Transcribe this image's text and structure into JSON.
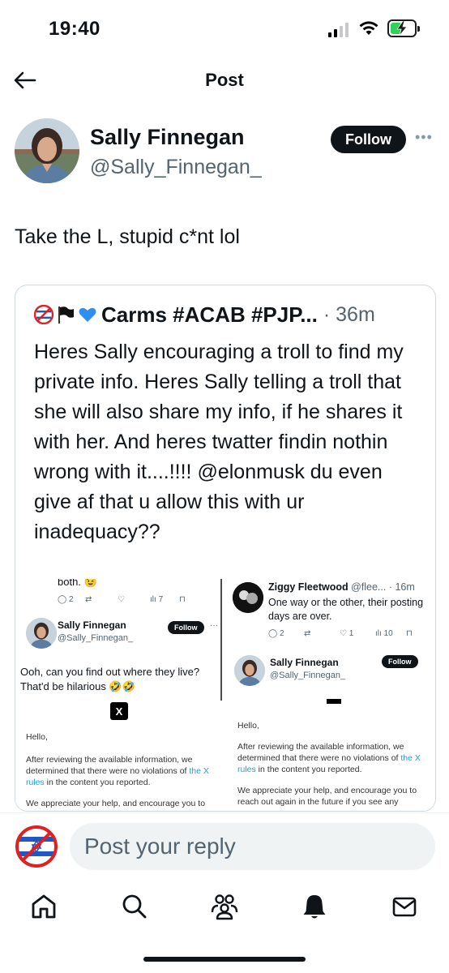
{
  "status_bar": {
    "time": "19:40",
    "battery_level": 0.44,
    "battery_color": "#30d158"
  },
  "header": {
    "title": "Post"
  },
  "post": {
    "author_name": "Sally Finnegan",
    "author_handle": "@Sally_Finnegan_",
    "follow_label": "Follow",
    "text": "Take the L, stupid c*nt lol"
  },
  "quoted": {
    "emojis": [
      "no-entry-flag-emoji",
      "black-flag-emoji",
      "blue-heart-emoji"
    ],
    "author_name": "Carms #ACAB #PJP...",
    "time": "36m",
    "text": "Heres Sally encouraging a troll to find my private info. Heres Sally telling a troll that she will also share my info, if he shares it with her. And heres twatter findin nothin wrong with it....!!!! @elonmusk du even give af that u allow this with ur inadequacy??",
    "media": {
      "left": {
        "top_text": "both. 😉",
        "actions": [
          "2",
          "",
          "",
          "7",
          ""
        ],
        "name": "Sally Finnegan",
        "handle": "@Sally_Finnegan_",
        "follow": "Follow",
        "text": "Ooh, can you find out where they live? That'd be hilarious 🤣🤣",
        "x_logo": "X",
        "email_hello": "Hello,",
        "email_p1_a": "After reviewing the available information, we determined that there were no violations of ",
        "email_p1_link": "the X rules",
        "email_p1_b": " in the content you reported.",
        "email_p2": "We appreciate your help, and encourage you to"
      },
      "right": {
        "name": "Ziggy Fleetwood",
        "handle": "@flee...",
        "time": "16m",
        "text": "One way or the other, their posting days are over.",
        "actions": [
          "2",
          "",
          "1",
          "10",
          ""
        ],
        "name2": "Sally Finnegan",
        "handle2": "@Sally_Finnegan_",
        "follow2": "Follow",
        "email_hello": "Hello,",
        "email_p1_a": "After reviewing the available information, we determined that there were no violations of ",
        "email_p1_link": "the X rules",
        "email_p1_b": " in the content you reported.",
        "email_p2": "We appreciate your help, and encourage you to reach out again in the future if you see any"
      }
    }
  },
  "reply": {
    "placeholder": "Post your reply"
  },
  "tabbar": {
    "items": [
      "home-icon",
      "search-icon",
      "communities-icon",
      "notifications-icon",
      "messages-icon"
    ]
  },
  "colors": {
    "text": "#0f1419",
    "muted": "#536471",
    "border": "#cfd9de",
    "link": "#1d9bf0"
  }
}
